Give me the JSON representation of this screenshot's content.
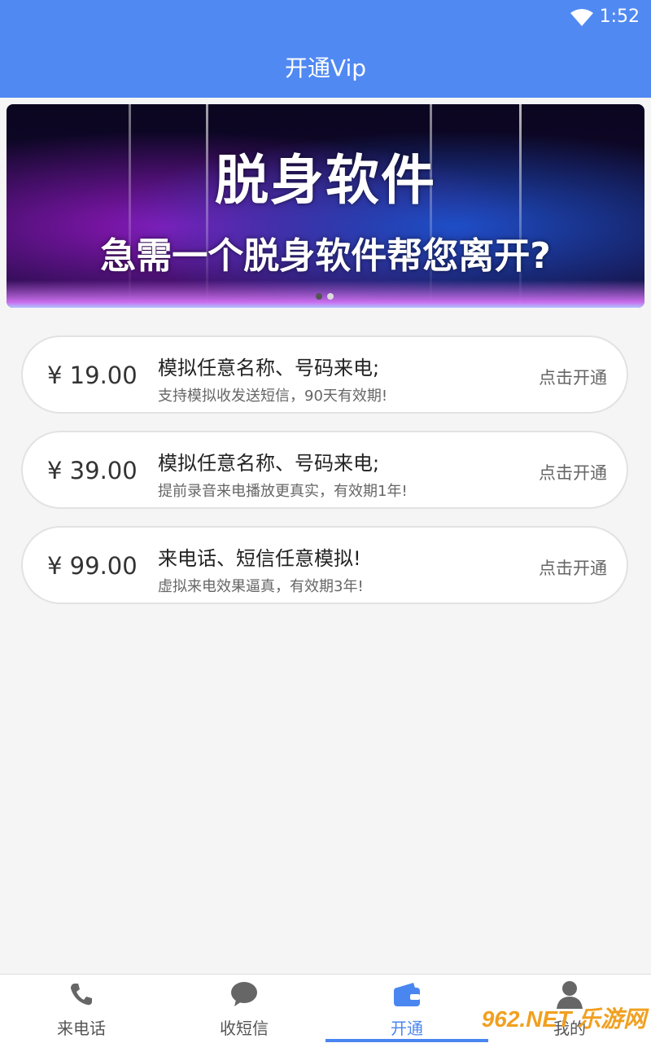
{
  "status_bar": {
    "time": "1:52"
  },
  "header": {
    "title": "开通Vip"
  },
  "banner": {
    "title": "脱身软件",
    "subtitle": "急需一个脱身软件帮您离开?"
  },
  "plans": [
    {
      "price": "¥ 19.00",
      "title": "模拟任意名称、号码来电;",
      "desc": "支持模拟收发送短信，90天有效期!",
      "action": "点击开通"
    },
    {
      "price": "¥ 39.00",
      "title": "模拟任意名称、号码来电;",
      "desc": "提前录音来电播放更真实，有效期1年!",
      "action": "点击开通"
    },
    {
      "price": "¥ 99.00",
      "title": "来电话、短信任意模拟!",
      "desc": "虚拟来电效果逼真，有效期3年!",
      "action": "点击开通"
    }
  ],
  "tabs": [
    {
      "label": "来电话",
      "icon": "phone-icon"
    },
    {
      "label": "收短信",
      "icon": "chat-bubble-icon"
    },
    {
      "label": "开通",
      "icon": "wallet-icon",
      "active": true
    },
    {
      "label": "我的",
      "icon": "user-icon"
    }
  ],
  "watermark": "962.NET 乐游网",
  "colors": {
    "primary": "#5189f2",
    "active_tab": "#4a86f0"
  }
}
